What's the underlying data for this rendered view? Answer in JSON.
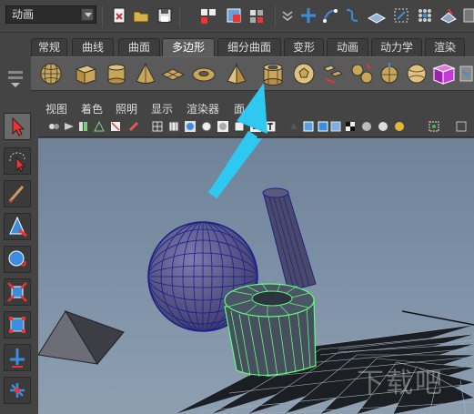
{
  "toolbar": {
    "mode_value": "动画",
    "icons": [
      "new-scene-icon",
      "open-scene-icon",
      "save-scene-icon",
      "selection-mode-icon",
      "component-mode-icon",
      "lock-selection-icon",
      "snap-grid-icon",
      "snap-curve-icon",
      "snap-point-icon",
      "snap-plane-icon",
      "snap-surface-icon",
      "make-live-icon"
    ]
  },
  "shelf": {
    "tabs": [
      "常规",
      "曲线",
      "曲面",
      "多边形",
      "细分曲面",
      "变形",
      "动画",
      "动力学",
      "渲染"
    ],
    "active_tab": "多边形",
    "icons": [
      "poly-sphere-icon",
      "poly-cube-icon",
      "poly-cylinder-icon",
      "poly-cone-icon",
      "poly-plane-icon",
      "poly-torus-icon",
      "poly-pyramid-icon",
      "poly-pipe-icon",
      "poly-soccer-ball-icon",
      "combine-icon",
      "separate-icon",
      "extract-icon",
      "smooth-icon",
      "boolean-icon",
      "mirror-icon"
    ]
  },
  "panel": {
    "menu": [
      "视图",
      "着色",
      "照明",
      "显示",
      "渲染器",
      "面"
    ]
  },
  "viewport": {
    "objects": [
      "sphere",
      "cylinder",
      "pipe",
      "pyramid"
    ],
    "selected": "pipe"
  },
  "watermark": "下载吧",
  "colors": {
    "arrow": "#2ec8f0",
    "wireframe": "#1d1d8c",
    "selected_wire": "#5fff7a",
    "viewport_top": "#6f8298",
    "viewport_bottom": "#8e9fb2"
  }
}
